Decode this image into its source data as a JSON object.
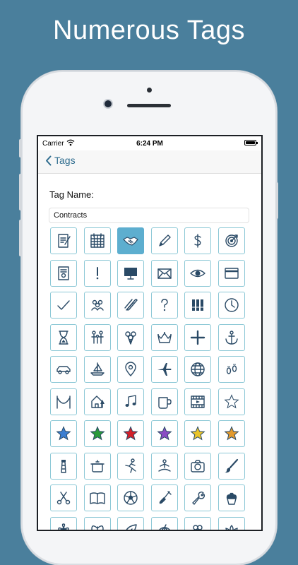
{
  "headline": "Numerous Tags",
  "status_bar": {
    "carrier": "Carrier",
    "time": "6:24 PM"
  },
  "nav": {
    "back_label": "Tags"
  },
  "form": {
    "tag_name_label": "Tag Name:",
    "tag_name_value": "Contracts"
  },
  "colors": {
    "accent": "#2f6d8f",
    "selected": "#5daecf",
    "cell_border": "#8cc8d6"
  },
  "icons": [
    "notepad-icon",
    "calendar-icon",
    "handshake-icon",
    "pencil-icon",
    "dollar-icon",
    "target-icon",
    "certificate-icon",
    "exclamation-icon",
    "monitor-icon",
    "envelope-icon",
    "eye-icon",
    "credit-card-icon",
    "checkmark-icon",
    "people-group-icon",
    "paperclip-icon",
    "question-icon",
    "binders-icon",
    "clock-icon",
    "hourglass-icon",
    "family-icon",
    "balloons-icon",
    "crown-icon",
    "plus-icon",
    "anchor-icon",
    "car-icon",
    "sailboat-icon",
    "map-pin-icon",
    "airplane-icon",
    "globe-icon",
    "footprints-icon",
    "hammock-icon",
    "house-icon",
    "music-note-icon",
    "mug-icon",
    "film-icon",
    "star-outline-icon",
    "star-blue-icon",
    "star-green-icon",
    "star-red-icon",
    "star-purple-icon",
    "star-yellow-icon",
    "star-orange-icon",
    "lighthouse-icon",
    "cooking-pot-icon",
    "runner-icon",
    "meditation-icon",
    "camera-icon",
    "paintbrush-icon",
    "scissors-icon",
    "book-icon",
    "soccer-ball-icon",
    "shovel-icon",
    "wrench-icon",
    "cupcake-icon",
    "flower-icon",
    "butterfly-icon",
    "leaf-icon",
    "pumpkin-icon",
    "clover-icon",
    "lotus-icon"
  ],
  "selected_icon": "handshake-icon"
}
